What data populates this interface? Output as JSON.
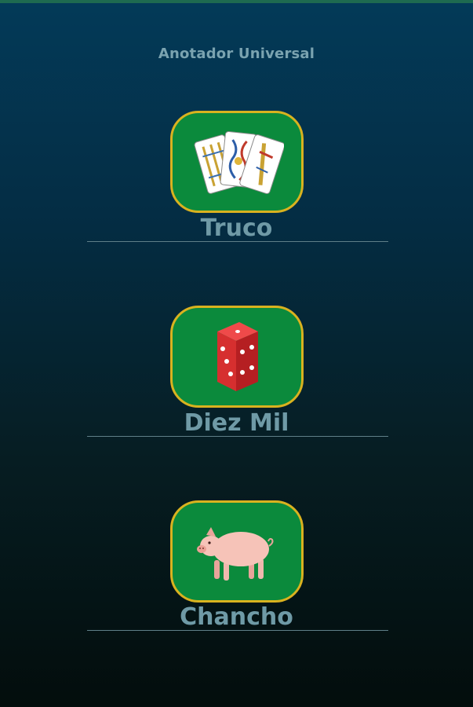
{
  "app": {
    "title": "Anotador Universal"
  },
  "games": [
    {
      "label": "Truco",
      "icon": "spanish-cards-icon"
    },
    {
      "label": "Diez Mil",
      "icon": "dice-icon"
    },
    {
      "label": "Chancho",
      "icon": "pig-icon"
    }
  ],
  "colors": {
    "tile_background": "#0b8a3c",
    "tile_border": "#d9b21f",
    "label_text": "#6f9aa6",
    "title_text": "#7aa3b0"
  }
}
